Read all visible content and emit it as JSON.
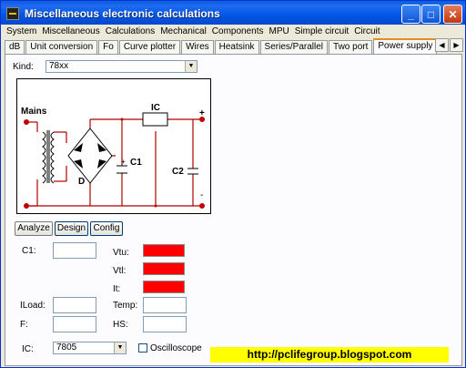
{
  "window": {
    "title": "Miscellaneous electronic calculations"
  },
  "titlebar_buttons": {
    "minimize": "_",
    "maximize": "□",
    "close": "✕"
  },
  "menu": [
    "System",
    "Miscellaneous",
    "Calculations",
    "Mechanical",
    "Components",
    "MPU",
    "Simple circuit",
    "Circuit"
  ],
  "tabs": [
    {
      "label": "dB"
    },
    {
      "label": "Unit conversion"
    },
    {
      "label": "Fo"
    },
    {
      "label": "Curve plotter"
    },
    {
      "label": "Wires"
    },
    {
      "label": "Heatsink"
    },
    {
      "label": "Series/Parallel"
    },
    {
      "label": "Two port"
    },
    {
      "label": "Power supply",
      "active": true
    }
  ],
  "tab_scroll": {
    "left": "◀",
    "right": "▶"
  },
  "kind": {
    "label": "Kind:",
    "value": "78xx"
  },
  "diagram": {
    "mains": "Mains",
    "ic": "IC",
    "c1": "C1",
    "c2": "C2",
    "d": "D",
    "plus": "+",
    "plus_small": "+",
    "minus": "-"
  },
  "mode_buttons": {
    "analyze": "Analyze",
    "design": "Design",
    "config": "Config"
  },
  "fields": {
    "c1": "C1:",
    "iload": "ILoad:",
    "f": "F:",
    "vtu": "Vtu:",
    "vtl": "Vtl:",
    "it": "It:",
    "temp": "Temp:",
    "hs": "HS:",
    "ic": "IC:"
  },
  "ic_select": "7805",
  "oscilloscope": "Oscilloscope",
  "url": "http://pclifegroup.blogspot.com",
  "colors": {
    "titlebar": "#0054e3",
    "indicator": "#ff0000",
    "wire": "#b00000",
    "banner": "#ffff00"
  }
}
